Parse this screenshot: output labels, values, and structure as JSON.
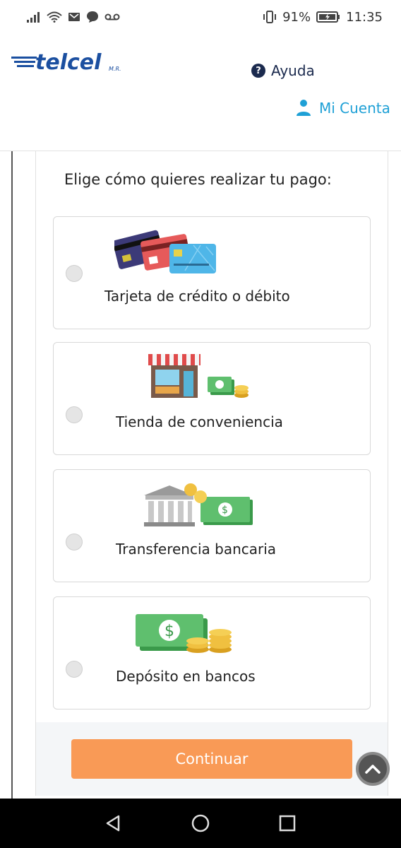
{
  "status_bar": {
    "battery": "91%",
    "time": "11:35"
  },
  "header": {
    "brand": "telcel",
    "brand_mark": "M.R.",
    "help_label": "Ayuda",
    "account_label": "Mi Cuenta"
  },
  "payment": {
    "prompt": "Elige cómo quieres realizar tu pago:",
    "options": [
      {
        "label": "Tarjeta de crédito o débito",
        "icon": "credit-cards-icon"
      },
      {
        "label": "Tienda de conveniencia",
        "icon": "store-cash-icon"
      },
      {
        "label": "Transferencia bancaria",
        "icon": "bank-transfer-icon"
      },
      {
        "label": "Depósito en bancos",
        "icon": "cash-deposit-icon"
      }
    ],
    "continue_label": "Continuar"
  },
  "colors": {
    "brand_blue": "#1b4fa0",
    "accent": "#1ea0d6",
    "button": "#f99a56"
  }
}
